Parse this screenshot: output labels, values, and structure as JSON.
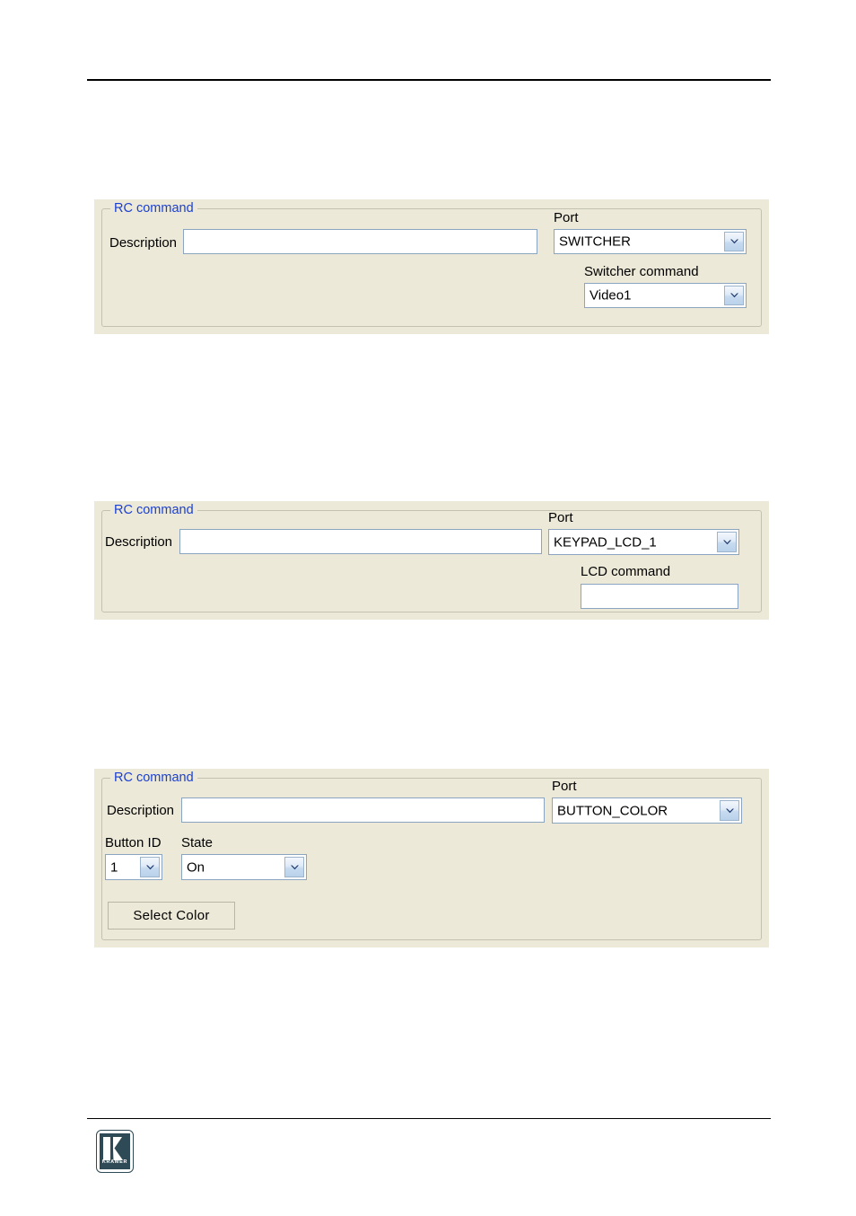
{
  "page": {
    "background_color": "#ffffff",
    "rule_color": "#000000"
  },
  "theme": {
    "panel_bg": "#ece9d8",
    "legend_color": "#1a3fd4",
    "field_border": "#8ba5c0",
    "field_bg": "#ffffff",
    "groupbox_border": "#c3c1b0",
    "arrow_color": "#1f3a6e",
    "logo_color": "#2d4a56"
  },
  "panels": [
    {
      "legend": "RC command",
      "description_label": "Description",
      "description_value": "",
      "port_label": "Port",
      "port_value": "SWITCHER",
      "port_options": [
        "SWITCHER"
      ],
      "secondary_label": "Switcher command",
      "secondary_value": "Video1",
      "secondary_options": [
        "Video1"
      ],
      "secondary_kind": "combobox"
    },
    {
      "legend": "RC command",
      "description_label": "Description",
      "description_value": "",
      "port_label": "Port",
      "port_value": "KEYPAD_LCD_1",
      "port_options": [
        "KEYPAD_LCD_1"
      ],
      "secondary_label": "LCD command",
      "secondary_value": "",
      "secondary_kind": "textbox"
    },
    {
      "legend": "RC command",
      "description_label": "Description",
      "description_value": "",
      "port_label": "Port",
      "port_value": "BUTTON_COLOR",
      "port_options": [
        "BUTTON_COLOR"
      ],
      "button_id_label": "Button ID",
      "button_id_value": "1",
      "button_id_options": [
        "1"
      ],
      "state_label": "State",
      "state_value": "On",
      "state_options": [
        "On"
      ],
      "select_color_label": "Select Color"
    }
  ],
  "footer": {
    "logo_wordmark": "KRAMER",
    "logo_letter": "K"
  }
}
